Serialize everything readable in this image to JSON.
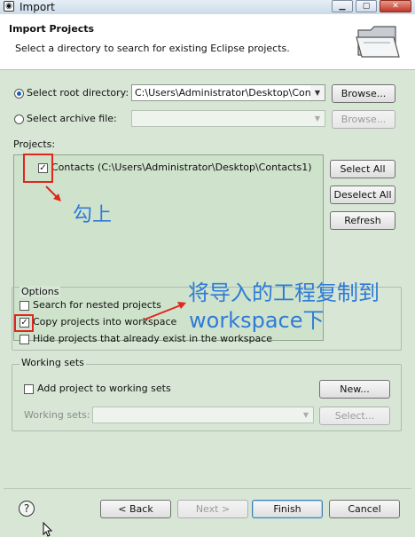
{
  "window": {
    "title": "Import",
    "controls": [
      "minimize",
      "maximize",
      "close"
    ]
  },
  "header": {
    "title": "Import Projects",
    "description": "Select a directory to search for existing Eclipse projects."
  },
  "source": {
    "root_radio_label": "Select root directory:",
    "root_selected": true,
    "root_path": "C:\\Users\\Administrator\\Desktop\\Cont",
    "root_browse": "Browse...",
    "archive_radio_label": "Select archive file:",
    "archive_path": "",
    "archive_browse": "Browse..."
  },
  "projects": {
    "label": "Projects:",
    "items": [
      {
        "label": "Contacts (C:\\Users\\Administrator\\Desktop\\Contacts1)",
        "checked": true
      }
    ],
    "select_all": "Select All",
    "deselect_all": "Deselect All",
    "refresh": "Refresh"
  },
  "options": {
    "label": "Options",
    "nested": {
      "label": "Search for nested projects",
      "checked": false
    },
    "copy": {
      "label": "Copy projects into workspace",
      "checked": true
    },
    "hide": {
      "label": "Hide projects that already exist in the workspace",
      "checked": false
    }
  },
  "working_sets": {
    "label": "Working sets",
    "add": {
      "label": "Add project to working sets",
      "checked": false
    },
    "new_button": "New...",
    "sets_label": "Working sets:",
    "select_button": "Select..."
  },
  "footer": {
    "back": "< Back",
    "next": "Next >",
    "finish": "Finish",
    "cancel": "Cancel"
  },
  "annotations": {
    "check_note": "勾上",
    "copy_note_line1": "将导入的工程复制到",
    "copy_note_line2": "workspace下",
    "color": "#2e7bd6",
    "highlight_color": "#e0261e"
  }
}
